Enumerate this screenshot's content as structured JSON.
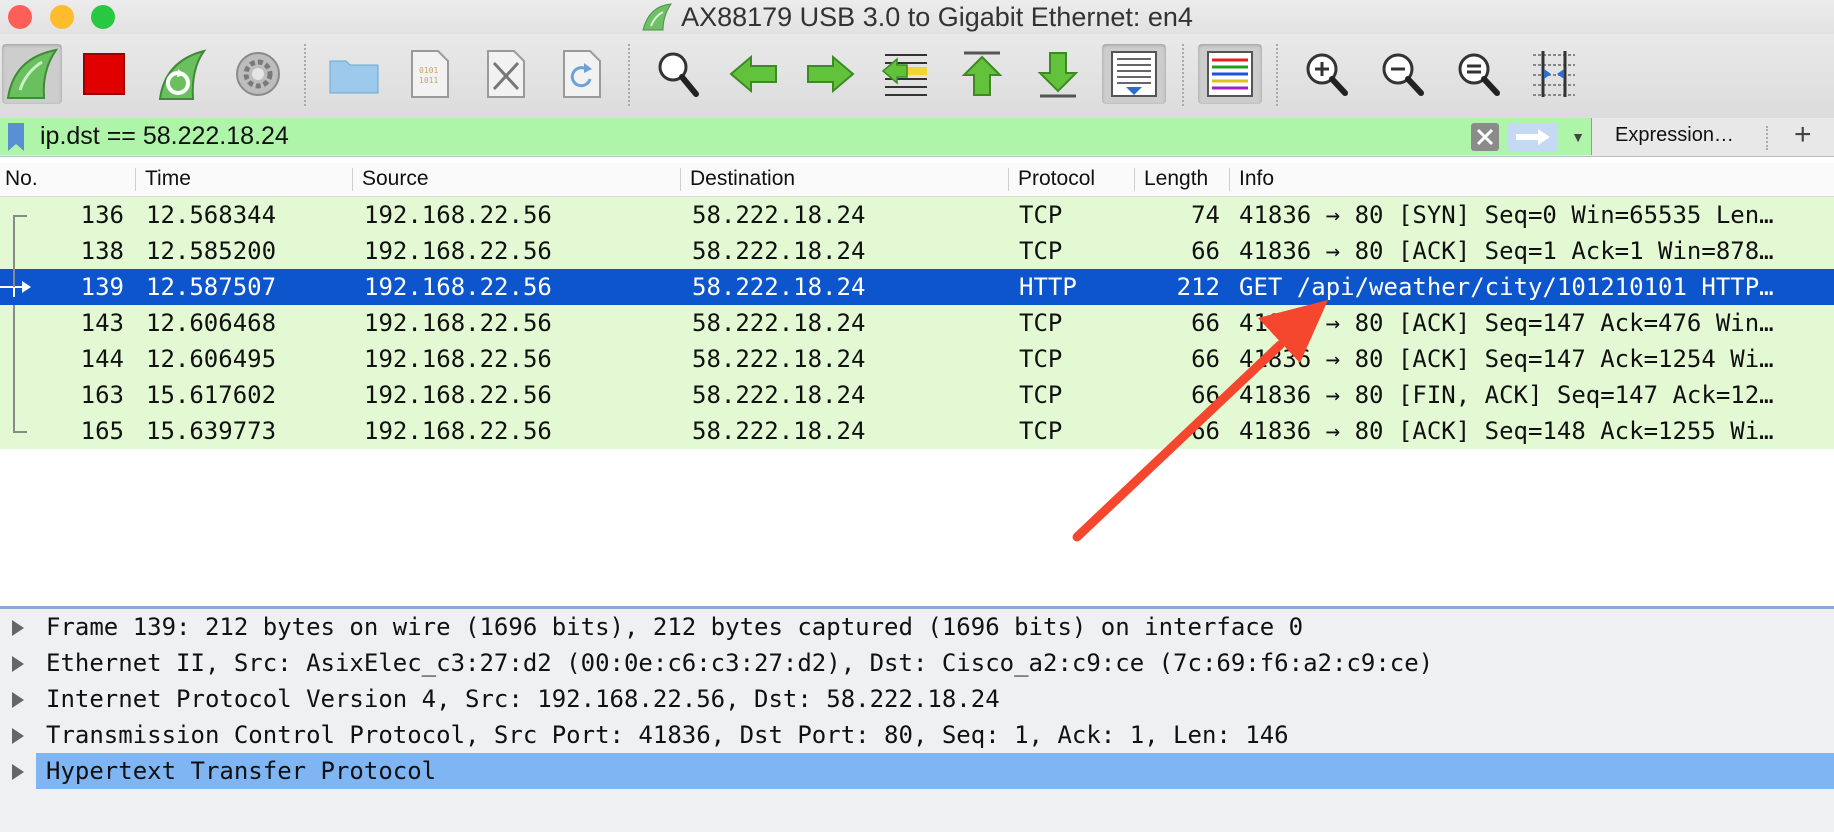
{
  "window": {
    "title": "AX88179 USB 3.0 to Gigabit Ethernet: en4",
    "traffic_lights": {
      "close": "#ff5f57",
      "minimize": "#febc2e",
      "zoom": "#28c840"
    }
  },
  "toolbar": {
    "buttons": [
      {
        "name": "start-capture-shark-icon"
      },
      {
        "name": "stop-capture-icon"
      },
      {
        "name": "restart-capture-icon"
      },
      {
        "name": "capture-options-gear-icon"
      },
      {
        "name": "open-file-folder-icon"
      },
      {
        "name": "save-file-icon"
      },
      {
        "name": "close-file-icon"
      },
      {
        "name": "reload-file-icon"
      },
      {
        "name": "find-packet-magnifier-icon"
      },
      {
        "name": "go-back-arrow-icon"
      },
      {
        "name": "go-forward-arrow-icon"
      },
      {
        "name": "go-to-packet-icon"
      },
      {
        "name": "first-packet-icon"
      },
      {
        "name": "last-packet-icon"
      },
      {
        "name": "auto-scroll-icon"
      },
      {
        "name": "colorize-icon"
      },
      {
        "name": "zoom-in-icon"
      },
      {
        "name": "zoom-out-icon"
      },
      {
        "name": "normal-size-icon"
      },
      {
        "name": "resize-columns-icon"
      }
    ]
  },
  "filter": {
    "value": "ip.dst == 58.222.18.24",
    "background": "#aff5a9",
    "expression_label": "Expression…",
    "add_label": "+"
  },
  "packet_list": {
    "headers": {
      "no": "No.",
      "time": "Time",
      "source": "Source",
      "destination": "Destination",
      "protocol": "Protocol",
      "length": "Length",
      "info": "Info"
    },
    "row_color": "#e3f9d4",
    "selected_color": "#0d55cc",
    "rows": [
      {
        "no": "136",
        "time": "12.568344",
        "source": "192.168.22.56",
        "destination": "58.222.18.24",
        "protocol": "TCP",
        "length": "74",
        "info": "41836 → 80 [SYN] Seq=0 Win=65535 Len…"
      },
      {
        "no": "138",
        "time": "12.585200",
        "source": "192.168.22.56",
        "destination": "58.222.18.24",
        "protocol": "TCP",
        "length": "66",
        "info": "41836 → 80 [ACK] Seq=1 Ack=1 Win=878…"
      },
      {
        "no": "139",
        "time": "12.587507",
        "source": "192.168.22.56",
        "destination": "58.222.18.24",
        "protocol": "HTTP",
        "length": "212",
        "info": "GET /api/weather/city/101210101 HTTP…",
        "selected": true
      },
      {
        "no": "143",
        "time": "12.606468",
        "source": "192.168.22.56",
        "destination": "58.222.18.24",
        "protocol": "TCP",
        "length": "66",
        "info": "41836 → 80 [ACK] Seq=147 Ack=476 Win…"
      },
      {
        "no": "144",
        "time": "12.606495",
        "source": "192.168.22.56",
        "destination": "58.222.18.24",
        "protocol": "TCP",
        "length": "66",
        "info": "41836 → 80 [ACK] Seq=147 Ack=1254 Wi…"
      },
      {
        "no": "163",
        "time": "15.617602",
        "source": "192.168.22.56",
        "destination": "58.222.18.24",
        "protocol": "TCP",
        "length": "66",
        "info": "41836 → 80 [FIN, ACK] Seq=147 Ack=12…"
      },
      {
        "no": "165",
        "time": "15.639773",
        "source": "192.168.22.56",
        "destination": "58.222.18.24",
        "protocol": "TCP",
        "length": "66",
        "info": "41836 → 80 [ACK] Seq=148 Ack=1255 Wi…"
      }
    ]
  },
  "details": {
    "selected_color": "#7fb5f3",
    "items": [
      {
        "text": "Frame 139: 212 bytes on wire (1696 bits), 212 bytes captured (1696 bits) on interface 0"
      },
      {
        "text": "Ethernet II, Src: AsixElec_c3:27:d2 (00:0e:c6:c3:27:d2), Dst: Cisco_a2:c9:ce (7c:69:f6:a2:c9:ce)"
      },
      {
        "text": "Internet Protocol Version 4, Src: 192.168.22.56, Dst: 58.222.18.24"
      },
      {
        "text": "Transmission Control Protocol, Src Port: 41836, Dst Port: 80, Seq: 1, Ack: 1, Len: 146"
      },
      {
        "text": "Hypertext Transfer Protocol",
        "selected": true
      }
    ]
  },
  "annotation": {
    "type": "red-arrow-icon",
    "color": "#f4472d"
  }
}
